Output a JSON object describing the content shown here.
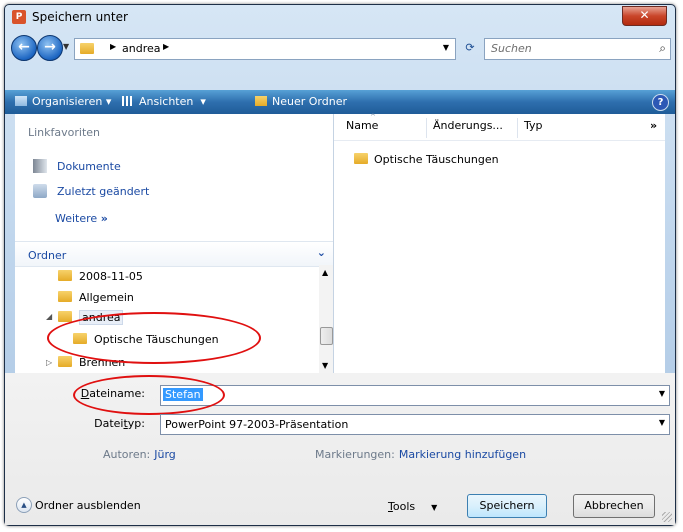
{
  "window": {
    "title": "Speichern unter",
    "close_label": "✕"
  },
  "nav": {
    "path": "andrea",
    "search_placeholder": "Suchen"
  },
  "toolbar": {
    "organize": "Organisieren",
    "views": "Ansichten",
    "new_folder": "Neuer Ordner",
    "help": "?"
  },
  "favorites": {
    "heading": "Linkfavoriten",
    "items": [
      "Dokumente",
      "Zuletzt geändert"
    ],
    "more": "Weitere"
  },
  "folders": {
    "heading": "Ordner",
    "tree": [
      "2008-11-05",
      "Allgemein",
      "andrea",
      "Optische Täuschungen",
      "Brennen"
    ]
  },
  "filelist": {
    "columns": [
      "Name",
      "Änderungs...",
      "Typ"
    ],
    "items": [
      "Optische Täuschungen"
    ]
  },
  "form": {
    "filename_label_prefix": "D",
    "filename_label_rest": "ateiname:",
    "filename_value": "Stefan",
    "filetype_label_a": "Datei",
    "filetype_label_u": "t",
    "filetype_label_b": "yp:",
    "filetype_value": "PowerPoint 97-2003-Präsentation",
    "authors_label": "Autoren:",
    "authors_value": "Jürg",
    "tags_label": "Markierungen:",
    "tags_value": "Markierung hinzufügen"
  },
  "footer": {
    "hide_folders": "Ordner ausblenden",
    "tools_u": "T",
    "tools_rest": "ools",
    "save": "Speichern",
    "cancel": "Abbrechen"
  },
  "colors": {
    "annotation": "#e01010",
    "toolbar": "#2e6fae",
    "link": "#1b4aa3"
  }
}
